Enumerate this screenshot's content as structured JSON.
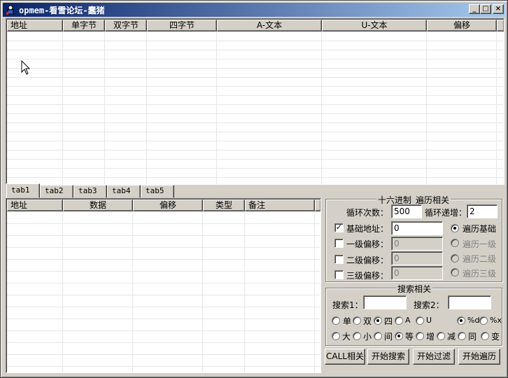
{
  "window": {
    "title": "opmem-看雪论坛-蠢猪",
    "minimize_glyph": "_",
    "maximize_glyph": "□",
    "close_glyph": "×"
  },
  "upper_table": {
    "columns": [
      "地址",
      "单字节",
      "双字节",
      "四字节",
      "A-文本",
      "U-文本",
      "偏移"
    ],
    "rows": []
  },
  "tabs": [
    "tab1",
    "tab2",
    "tab3",
    "tab4",
    "tab5"
  ],
  "active_tab": "tab1",
  "lower_table": {
    "columns": [
      "地址",
      "数据",
      "偏移",
      "类型",
      "备注"
    ],
    "rows": []
  },
  "hex_group": {
    "title": "十六进制_遍历相关",
    "loop_count_label": "循环次数：",
    "loop_count_value": "500",
    "loop_step_label": "循环递增：",
    "loop_step_value": "2",
    "base_addr_label": "基础地址：",
    "base_addr_value": "0",
    "level1_label": "一级偏移：",
    "level1_value": "0",
    "level2_label": "二级偏移：",
    "level2_value": "0",
    "level3_label": "三级偏移：",
    "level3_value": "0",
    "traverse_base": "遍历基础",
    "traverse_1": "遍历一级",
    "traverse_2": "遍历二级",
    "traverse_3": "遍历三级"
  },
  "search_group": {
    "title": "搜索相关",
    "search1_label": "搜索1：",
    "search1_value": "",
    "search2_label": "搜索2：",
    "search2_value": "",
    "opt_single": "单",
    "opt_double": "双",
    "opt_quad": "四",
    "opt_a": "A",
    "opt_u": "U",
    "opt_pct_d": "%d",
    "opt_pct_x": "%x",
    "opt_greater": "大",
    "opt_less": "小",
    "opt_between": "间",
    "opt_equal": "等",
    "opt_inc": "增",
    "opt_dec": "减",
    "opt_same": "同",
    "opt_change": "变"
  },
  "buttons": {
    "call": "CALL相关",
    "start_search": "开始搜索",
    "start_filter": "开始过滤",
    "start_traverse": "开始遍历"
  }
}
